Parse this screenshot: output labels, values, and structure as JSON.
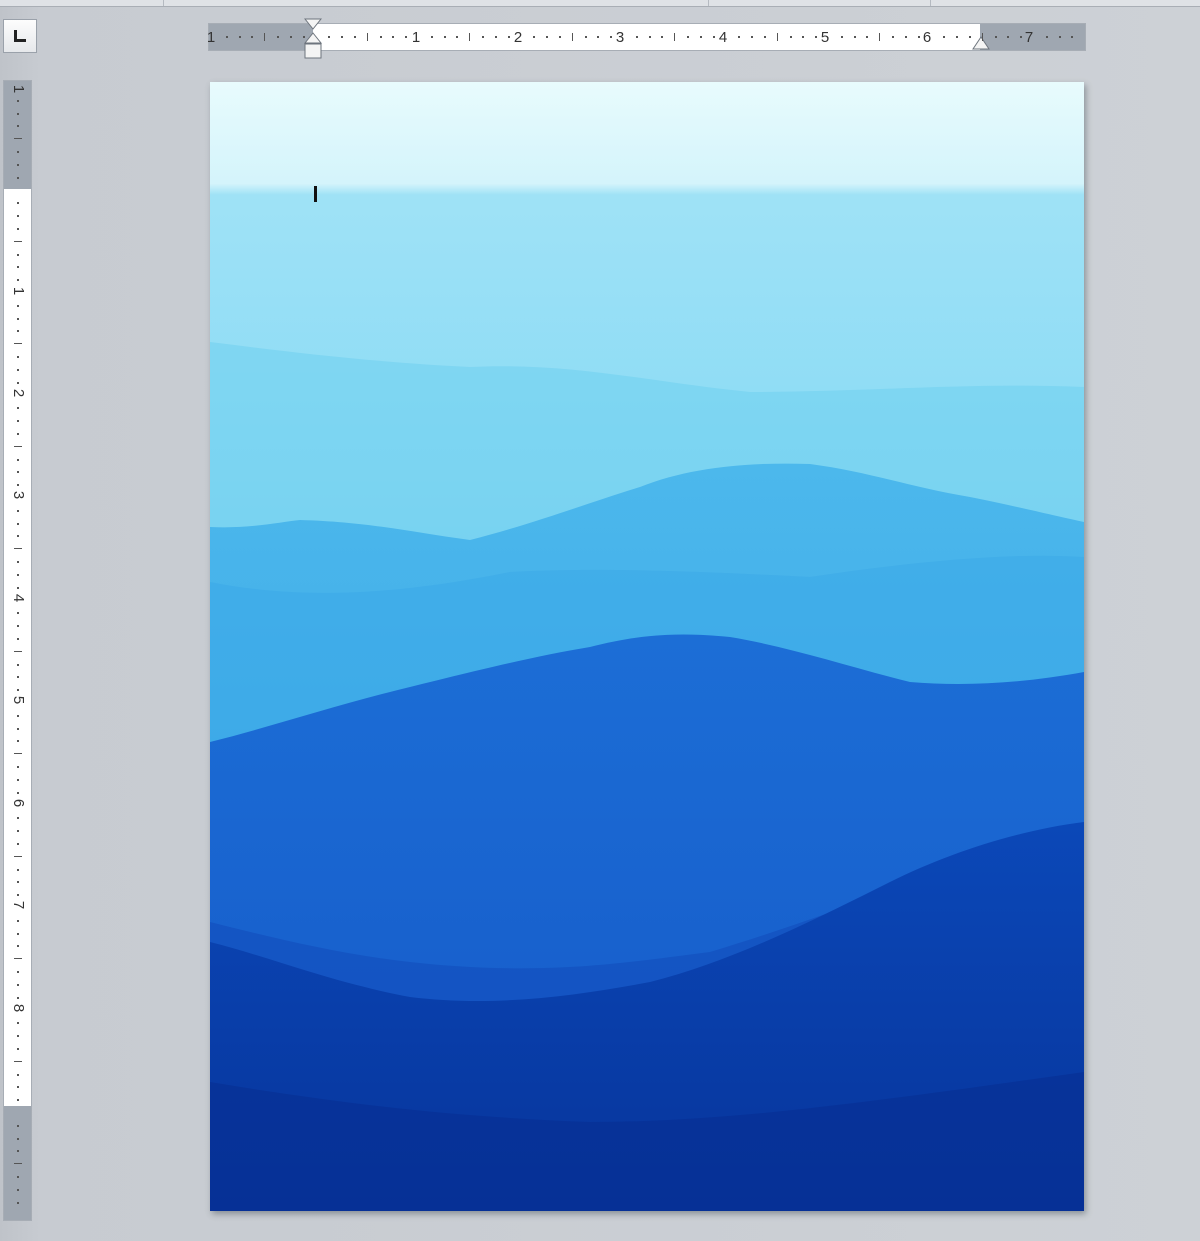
{
  "app": {
    "view": "Print Layout",
    "tab_selector": {
      "icon": "left-tab-icon",
      "type": "Left tab"
    }
  },
  "horizontal_ruler": {
    "labels": [
      "1",
      "1",
      "2",
      "3",
      "4",
      "5",
      "6",
      "7"
    ]
  },
  "vertical_ruler": {
    "labels": [
      "1",
      "1",
      "2",
      "3",
      "4",
      "5",
      "6",
      "7",
      "8"
    ]
  },
  "document": {
    "background_image": "blue-mountain-ridges-image",
    "colors": {
      "sky_top": "#e8fbfd",
      "ridge_1": "#6fd0ee",
      "ridge_2": "#45b4ea",
      "ridge_3": "#1f6fd6",
      "ridge_4": "#0b45b6",
      "ridge_5": "#0838a0"
    }
  }
}
